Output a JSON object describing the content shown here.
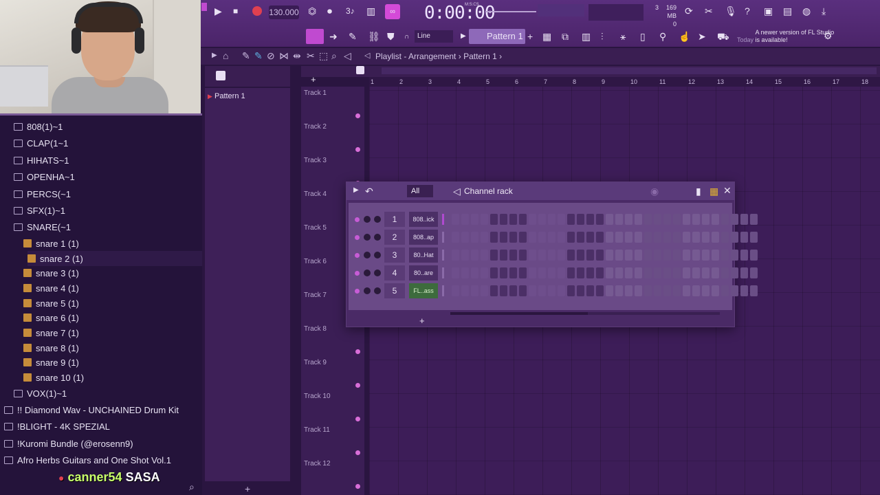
{
  "transport": {
    "tempo": "130.000",
    "time": "0:00:00",
    "time_unit": "M:S:CS",
    "memory_top": "3",
    "memory_mb": "169 MB",
    "memory_bottom": "0"
  },
  "toolbar": {
    "pattern": "Pattern 1",
    "snap": "Line",
    "news_date": "Today",
    "news_text": "A newer version of FL Studio is available!"
  },
  "browser": {
    "items": [
      {
        "label": "808(1)~1",
        "type": "folder"
      },
      {
        "label": "CLAP(1~1",
        "type": "folder"
      },
      {
        "label": "HIHATS~1",
        "type": "folder"
      },
      {
        "label": "OPENHA~1",
        "type": "folder"
      },
      {
        "label": "PERCS(~1",
        "type": "folder"
      },
      {
        "label": "SFX(1)~1",
        "type": "folder"
      },
      {
        "label": "SNARE(~1",
        "type": "folder"
      },
      {
        "label": "snare 1 (1)",
        "type": "sound"
      },
      {
        "label": "snare 2 (1)",
        "type": "sound"
      },
      {
        "label": "snare 3 (1)",
        "type": "sound"
      },
      {
        "label": "snare 4 (1)",
        "type": "sound"
      },
      {
        "label": "snare 5 (1)",
        "type": "sound"
      },
      {
        "label": "snare 6 (1)",
        "type": "sound"
      },
      {
        "label": "snare 7 (1)",
        "type": "sound"
      },
      {
        "label": "snare 8 (1)",
        "type": "sound"
      },
      {
        "label": "snare 9 (1)",
        "type": "sound"
      },
      {
        "label": "snare 10 (1)",
        "type": "sound"
      },
      {
        "label": "VOX(1)~1",
        "type": "folder"
      },
      {
        "label": "!! Diamond Wav - UNCHAINED Drum Kit",
        "type": "folder"
      },
      {
        "label": "!BLIGHT - 4K SPEZIAL",
        "type": "folder"
      },
      {
        "label": "!Kuromi Bundle (@erosenn9)",
        "type": "folder"
      },
      {
        "label": "Afro Herbs Guitars and One Shot Vol.1",
        "type": "folder"
      }
    ],
    "stream_user": "canner54",
    "stream_tag": "SASA"
  },
  "playlist": {
    "path": "Playlist - Arrangement",
    "pattern": "Pattern 1",
    "picker_pattern": "Pattern 1",
    "tracks": [
      "Track 1",
      "Track 2",
      "Track 3",
      "Track 4",
      "Track 5",
      "Track 6",
      "Track 7",
      "Track 8",
      "Track 9",
      "Track 10",
      "Track 11",
      "Track 12"
    ],
    "ruler": [
      "1",
      "2",
      "3",
      "4",
      "5",
      "6",
      "7",
      "8",
      "9",
      "10",
      "11",
      "12",
      "13",
      "14",
      "15",
      "16",
      "17",
      "18"
    ]
  },
  "channel_rack": {
    "title": "Channel rack",
    "filter": "All",
    "channels": [
      {
        "num": "1",
        "name": "808..ick"
      },
      {
        "num": "2",
        "name": "808..ap"
      },
      {
        "num": "3",
        "name": "80..Hat"
      },
      {
        "num": "4",
        "name": "80..are"
      },
      {
        "num": "5",
        "name": "FL..ass"
      }
    ]
  },
  "colors": {
    "accent": "#c75cd6",
    "step_dark": "#4b2f66",
    "step_light": "#6e4e8c",
    "record": "#e04050"
  }
}
